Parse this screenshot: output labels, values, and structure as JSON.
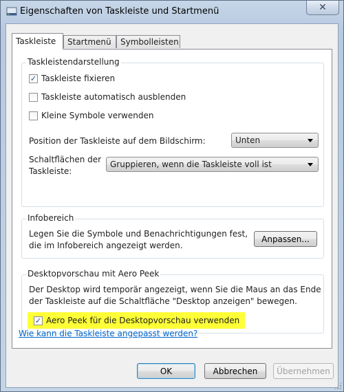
{
  "window": {
    "title": "Eigenschaften von Taskleiste und Startmenü",
    "close_symbol": "✕"
  },
  "tabs": [
    {
      "label": "Taskleiste",
      "active": true
    },
    {
      "label": "Startmenü",
      "active": false
    },
    {
      "label": "Symbolleisten",
      "active": false
    }
  ],
  "appearance_group": {
    "title": "Taskleistendarstellung",
    "checkboxes": [
      {
        "label": "Taskleiste fixieren",
        "checked": true
      },
      {
        "label": "Taskleiste automatisch ausblenden",
        "checked": false
      },
      {
        "label": "Kleine Symbole verwenden",
        "checked": false
      }
    ],
    "position_label": "Position der Taskleiste auf dem Bildschirm:",
    "position_value": "Unten",
    "buttons_label_line1": "Schaltflächen der",
    "buttons_label_line2": "Taskleiste:",
    "buttons_value": "Gruppieren, wenn die Taskleiste voll ist"
  },
  "notification_group": {
    "title": "Infobereich",
    "text_line1": "Legen Sie die Symbole und Benachrichtigungen fest,",
    "text_line2": "die im Infobereich angezeigt werden.",
    "customize_label": "Anpassen..."
  },
  "aero_group": {
    "title": "Desktopvorschau mit Aero Peek",
    "text_line1": "Der Desktop wird temporär angezeigt, wenn Sie die Maus an das Ende",
    "text_line2": "der Taskleiste auf die Schaltfläche \"Desktop anzeigen\" bewegen.",
    "checkbox_label": "Aero Peek für die Desktopvorschau verwenden",
    "checkbox_checked": true,
    "highlight_color": "#ffff38"
  },
  "help_link": "Wie kann die Taskleiste angepasst werden?",
  "footer": {
    "ok_label": "OK",
    "cancel_label": "Abbrechen",
    "apply_label": "Übernehmen"
  },
  "icons": {
    "window": "taskbar-properties-icon",
    "check": "✓"
  }
}
